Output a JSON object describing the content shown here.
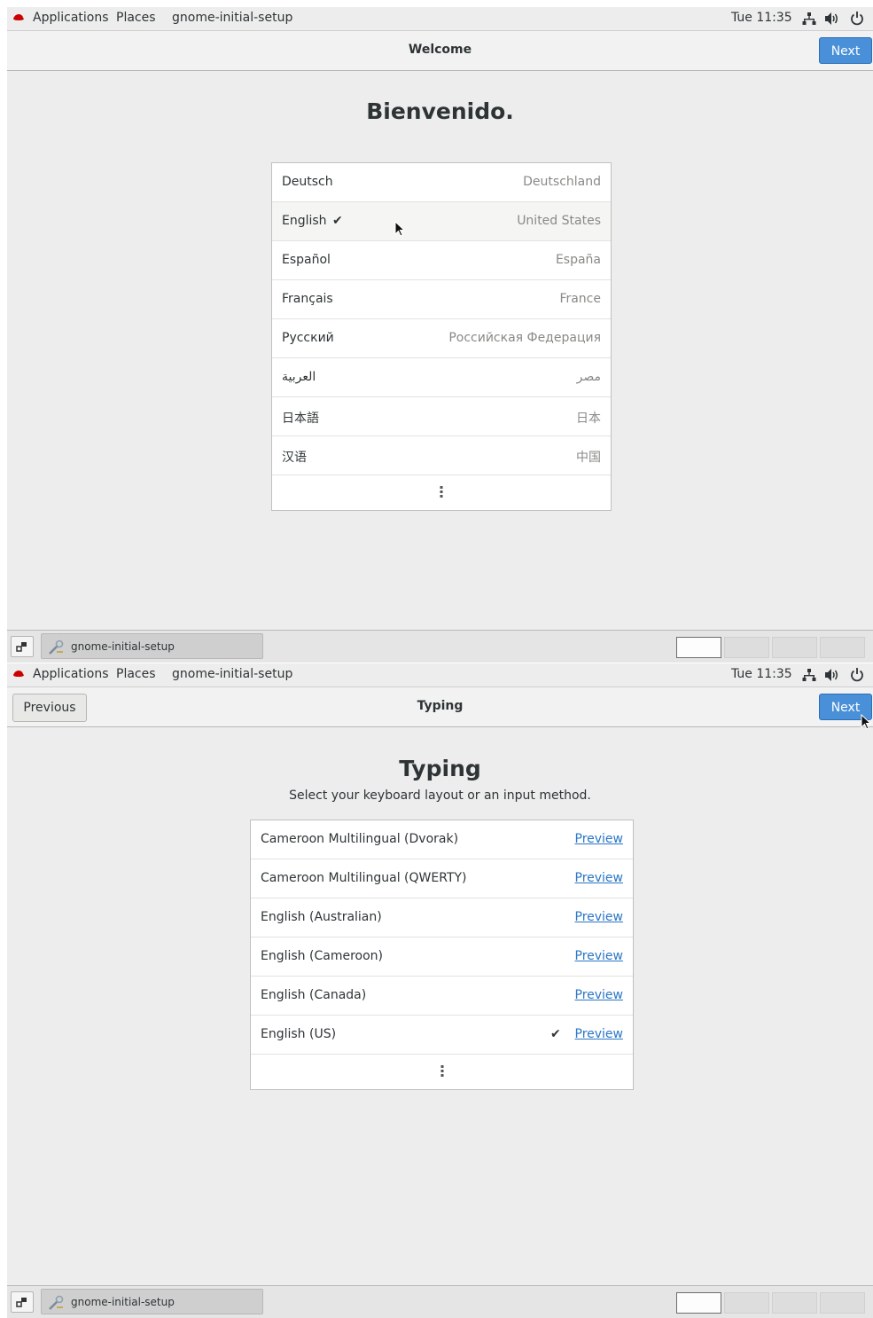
{
  "screens": [
    {
      "top_panel": {
        "applications": "Applications",
        "places": "Places",
        "app_name": "gnome-initial-setup",
        "clock": "Tue 11:35"
      },
      "header": {
        "title": "Welcome",
        "next": "Next"
      },
      "heading": "Bienvenido.",
      "languages": [
        {
          "name": "Deutsch",
          "region": "Deutschland",
          "selected": false
        },
        {
          "name": "English",
          "region": "United States",
          "selected": true
        },
        {
          "name": "Español",
          "region": "España",
          "selected": false
        },
        {
          "name": "Français",
          "region": "France",
          "selected": false
        },
        {
          "name": "Русский",
          "region": "Российская Федерация",
          "selected": false
        },
        {
          "name": "العربية",
          "region": "مصر",
          "selected": false
        },
        {
          "name": "日本語",
          "region": "日本",
          "selected": false
        },
        {
          "name": "汉语",
          "region": "中国",
          "selected": false
        }
      ],
      "check": "✔",
      "taskbar": {
        "task_label": "gnome-initial-setup"
      }
    },
    {
      "top_panel": {
        "applications": "Applications",
        "places": "Places",
        "app_name": "gnome-initial-setup",
        "clock": "Tue 11:35"
      },
      "header": {
        "previous": "Previous",
        "title": "Typing",
        "next": "Next"
      },
      "heading": "Typing",
      "subtitle": "Select your keyboard layout or an input method.",
      "layouts": [
        {
          "name": "Cameroon Multilingual (Dvorak)",
          "preview": "Preview",
          "selected": false
        },
        {
          "name": "Cameroon Multilingual (QWERTY)",
          "preview": "Preview",
          "selected": false
        },
        {
          "name": "English (Australian)",
          "preview": "Preview",
          "selected": false
        },
        {
          "name": "English (Cameroon)",
          "preview": "Preview",
          "selected": false
        },
        {
          "name": "English (Canada)",
          "preview": "Preview",
          "selected": false
        },
        {
          "name": "English (US)",
          "preview": "Preview",
          "selected": true
        }
      ],
      "check": "✔",
      "taskbar": {
        "task_label": "gnome-initial-setup"
      }
    }
  ],
  "colors": {
    "accent": "#4a90d9",
    "link": "#2a76c6",
    "redhat": "#cc0000"
  },
  "icons": {
    "logo": "redhat-icon",
    "network": "network-icon",
    "volume": "volume-icon",
    "power": "power-icon",
    "show_desktop": "show-desktop-icon",
    "task": "setup-tool-icon",
    "more": "more-vertical-icon"
  }
}
